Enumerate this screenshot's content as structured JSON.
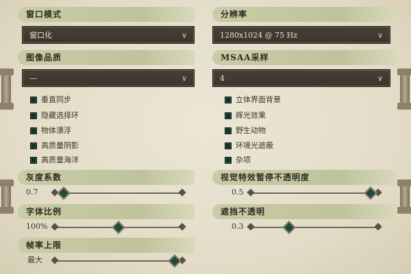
{
  "display_mode": {
    "label": "窗口模式",
    "value": "窗口化"
  },
  "resolution": {
    "label": "分辨率",
    "value": "1280x1024 @ 75 Hz"
  },
  "image_quality": {
    "label": "图像品质",
    "value": "—"
  },
  "msaa": {
    "label": "MSAA采样",
    "value": "4"
  },
  "left_checkboxes": [
    {
      "label": "垂直同步",
      "checked": true
    },
    {
      "label": "隐藏选择环",
      "checked": true
    },
    {
      "label": "物体漂浮",
      "checked": true
    },
    {
      "label": "高质量阴影",
      "checked": true
    },
    {
      "label": "高质量海洋",
      "checked": true
    }
  ],
  "right_checkboxes": [
    {
      "label": "立体界面背景",
      "checked": true
    },
    {
      "label": "辉光效果",
      "checked": true
    },
    {
      "label": "野生动物",
      "checked": true
    },
    {
      "label": "环境光遮蔽",
      "checked": true
    },
    {
      "label": "杂项",
      "checked": true
    }
  ],
  "sliders": {
    "gamma": {
      "label": "灰度系数",
      "value_text": "0.7",
      "level": 0.07
    },
    "vfx_pause_opacity": {
      "label": "视觉特效暂停不透明度",
      "value_text": "0.5",
      "level": 0.94
    },
    "font_scale": {
      "label": "字体比例",
      "value_text": "100%",
      "level": 0.5
    },
    "occluder_opacity": {
      "label": "遮挡不透明",
      "value_text": "0.3",
      "level": 0.3
    },
    "frame_cap": {
      "label": "帧率上限",
      "value_text": "最大",
      "level": 0.94
    }
  },
  "colors": {
    "header_bg": "#c2c59e",
    "dropdown_bg": "#3f392f",
    "checkbox": "#143026",
    "slider_thumb": "#1f4a3c",
    "parchment": "#e8e2d0"
  },
  "icons": {
    "dropdown_arrow": "chevron-down-icon",
    "slider_thumb": "diamond-thumb-icon"
  }
}
